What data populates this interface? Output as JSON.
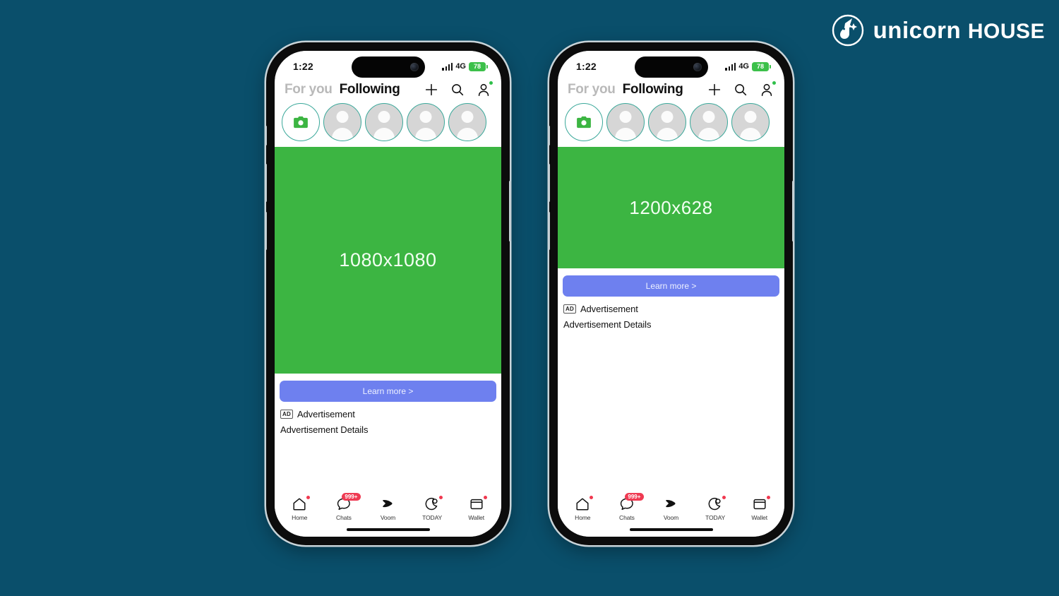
{
  "background_color": "#0a4f6b",
  "brand": {
    "name_part_1": "unicorn",
    "name_part_2": "HOUSE",
    "logo_icon": "unicorn-head-circle-icon",
    "text_color": "#ffffff"
  },
  "status_bar": {
    "time": "1:22",
    "network": "4G",
    "battery_percent": "78",
    "battery_color": "#3cc04a",
    "signal_icon": "signal-bars-icon"
  },
  "app_header": {
    "tab_inactive": "For you",
    "tab_active": "Following",
    "icons": [
      {
        "name": "plus-icon"
      },
      {
        "name": "search-icon"
      },
      {
        "name": "profile-icon",
        "badge": true
      }
    ],
    "badge_color": "#2fbf4a"
  },
  "stories": {
    "camera_label": "camera-story-icon",
    "items": [
      {
        "type": "camera"
      },
      {
        "type": "avatar"
      },
      {
        "type": "avatar"
      },
      {
        "type": "avatar"
      },
      {
        "type": "avatar"
      }
    ],
    "ring_color": "#3aa89a"
  },
  "phones": [
    {
      "id": "phone-square",
      "creative_label": "1080x1080",
      "creative_color": "#3cb542"
    },
    {
      "id": "phone-landscape",
      "creative_label": "1200x628",
      "creative_color": "#3cb542"
    }
  ],
  "ad": {
    "cta_label": "Learn more >",
    "cta_color": "#6e80ef",
    "badge": "AD",
    "title": "Advertisement",
    "details": "Advertisement Details"
  },
  "bottom_nav": {
    "items": [
      {
        "label": "Home",
        "icon": "home-icon",
        "badge_dot": true,
        "badge_count": ""
      },
      {
        "label": "Chats",
        "icon": "chat-icon",
        "badge_dot": false,
        "badge_count": "999+"
      },
      {
        "label": "Voom",
        "icon": "voom-icon",
        "badge_dot": false,
        "badge_count": ""
      },
      {
        "label": "TODAY",
        "icon": "today-icon",
        "badge_dot": true,
        "badge_count": ""
      },
      {
        "label": "Wallet",
        "icon": "wallet-icon",
        "badge_dot": true,
        "badge_count": ""
      }
    ],
    "badge_color": "#ef3a52"
  }
}
